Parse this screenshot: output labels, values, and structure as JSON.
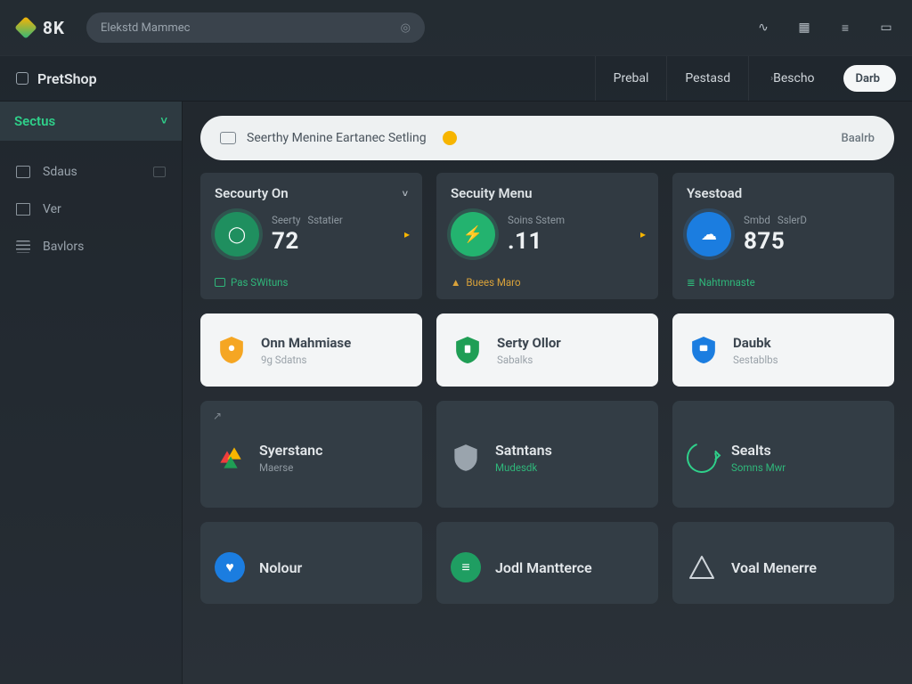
{
  "topbar": {
    "brand": "8K",
    "search_placeholder": "Elekstd Mammec",
    "icons": [
      "activity",
      "grid",
      "menu",
      "card"
    ]
  },
  "appbar": {
    "title": "PretShop",
    "tabs": [
      {
        "label": "Prebal"
      },
      {
        "label": "Pestasd"
      },
      {
        "label": "Bescho",
        "caret": true
      }
    ],
    "action_label": "Darb"
  },
  "sidebar": {
    "active": {
      "label": "Sectus"
    },
    "items": [
      {
        "label": "Sdaus",
        "trail": true
      },
      {
        "label": "Ver"
      },
      {
        "label": "Bavlors"
      }
    ]
  },
  "notice": {
    "text": "Seerthy Menine Eartanec Setling",
    "right": "Baalrb"
  },
  "stats": [
    {
      "title": "Secourty On",
      "sub1": "Seerty",
      "sub2": "Sstatier",
      "value": "72",
      "foot": "Pas SWituns",
      "circle": "green",
      "arrow": true,
      "chev": true
    },
    {
      "title": "Secuity Menu",
      "sub1": "Soins Sstem",
      "sub2": "",
      "value": ".11",
      "foot": "Buees Maro",
      "circle": "green2",
      "arrow": true,
      "foot_amber": true
    },
    {
      "title": "Ysestoad",
      "sub1": "Smbd",
      "sub2": "SslerD",
      "value": "875",
      "foot": "Nahtmnaste",
      "circle": "blue"
    }
  ],
  "tiles": [
    {
      "title": "Onn Mahmiase",
      "sub": "9g Sdatns",
      "icon": "shield-amber"
    },
    {
      "title": "Serty Ollor",
      "sub": "Sabalks",
      "icon": "shield-green"
    },
    {
      "title": "Daubk",
      "sub": "Sestablbs",
      "icon": "shield-blue-sq"
    }
  ],
  "grid1": [
    {
      "top": "↗",
      "title": "Syerstanc",
      "sub": "Maerse",
      "icon": "tri-multi",
      "sub_muted": true
    },
    {
      "top": "",
      "title": "Satntans",
      "sub": "Mudesdk",
      "icon": "shield-outline"
    },
    {
      "top": "",
      "title": "Sealts",
      "sub": "Somns Mwr",
      "icon": "ring-green"
    }
  ],
  "grid2": [
    {
      "title": "Nolour",
      "icon": "circ-blue-heart"
    },
    {
      "title": "Jodl Mantterce",
      "icon": "circ-green-bars"
    },
    {
      "title": "Voal Menerre",
      "icon": "tri-outline"
    }
  ]
}
